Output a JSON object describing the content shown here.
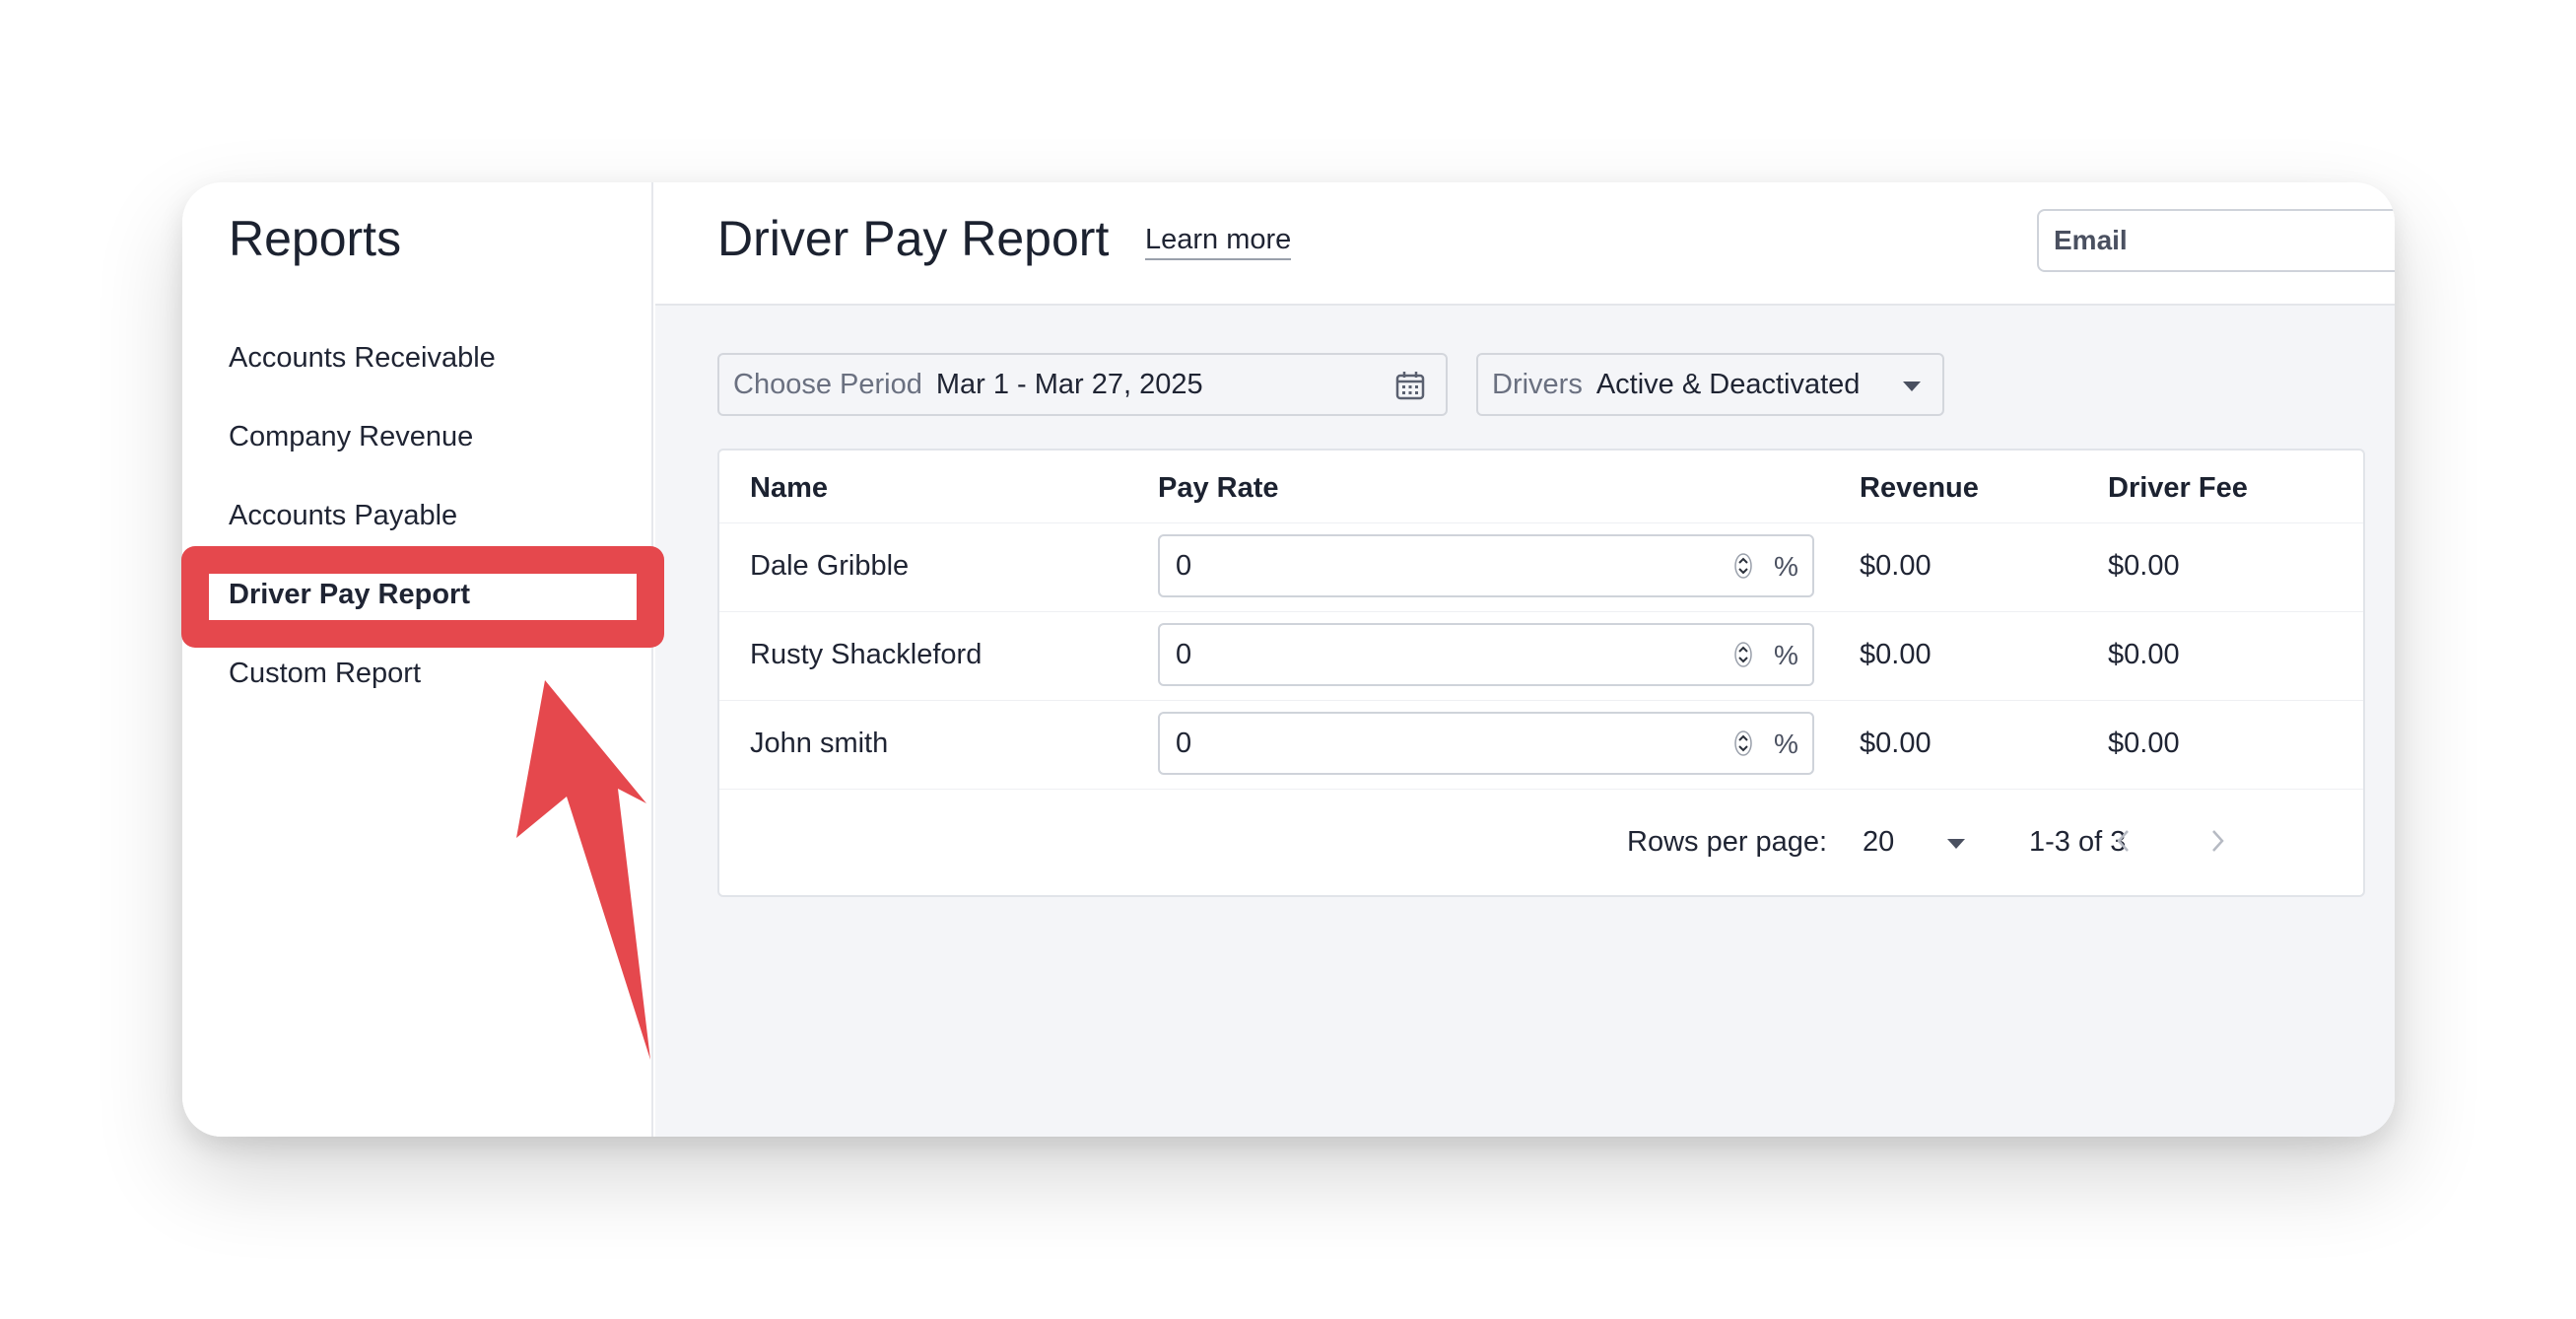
{
  "sidebar": {
    "title": "Reports",
    "items": [
      {
        "label": "Accounts Receivable"
      },
      {
        "label": "Company Revenue"
      },
      {
        "label": "Accounts Payable"
      },
      {
        "label": "Driver Pay Report",
        "active": true
      },
      {
        "label": "Custom Report"
      }
    ]
  },
  "header": {
    "title": "Driver Pay Report",
    "learn_more": "Learn more",
    "email_placeholder": "Email"
  },
  "filters": {
    "period_label": "Choose Period",
    "period_value": "Mar 1 - Mar 27, 2025",
    "period_icon": "calendar-icon",
    "drivers_label": "Drivers",
    "drivers_value": "Active & Deactivated"
  },
  "table": {
    "columns": [
      "Name",
      "Pay Rate",
      "Revenue",
      "Driver Fee"
    ],
    "rows": [
      {
        "name": "Dale Gribble",
        "pay_rate": "0",
        "unit": "%",
        "revenue": "$0.00",
        "driver_fee": "$0.00"
      },
      {
        "name": "Rusty Shackleford",
        "pay_rate": "0",
        "unit": "%",
        "revenue": "$0.00",
        "driver_fee": "$0.00"
      },
      {
        "name": "John smith",
        "pay_rate": "0",
        "unit": "%",
        "revenue": "$0.00",
        "driver_fee": "$0.00"
      }
    ],
    "pagination": {
      "rows_per_page_label": "Rows per page:",
      "rows_per_page_value": "20",
      "range": "1-3 of 3"
    }
  },
  "annotation": {
    "color": "#e5484d",
    "target": "Driver Pay Report"
  }
}
